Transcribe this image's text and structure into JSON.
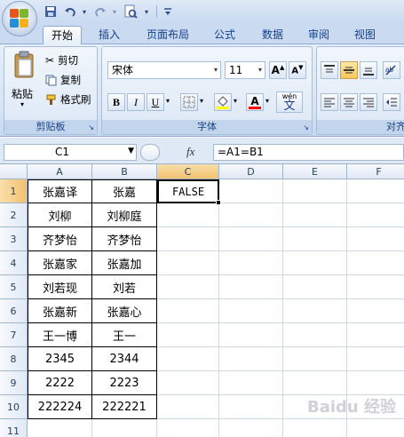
{
  "quick_access": {
    "icons": [
      "save-icon",
      "undo-icon",
      "redo-icon",
      "print-preview-icon",
      "customize-icon"
    ]
  },
  "tabs": [
    "开始",
    "插入",
    "页面布局",
    "公式",
    "数据",
    "审阅",
    "视图"
  ],
  "active_tab": "开始",
  "ribbon": {
    "clipboard": {
      "label": "剪贴板",
      "paste": "粘贴",
      "cut": "剪切",
      "copy": "复制",
      "format_painter": "格式刷"
    },
    "font": {
      "label": "字体",
      "font_name": "宋体",
      "font_size": "11",
      "bold": "B",
      "italic": "I",
      "underline": "U",
      "font_color_letter": "A",
      "phonetic": "wén"
    },
    "alignment": {
      "label": "对齐"
    }
  },
  "formula_bar": {
    "name_box": "C1",
    "fx": "fx",
    "formula": "=A1=B1"
  },
  "columns": [
    "A",
    "B",
    "C",
    "D",
    "E",
    "F"
  ],
  "selected_column": "C",
  "rows": [
    "1",
    "2",
    "3",
    "4",
    "5",
    "6",
    "7",
    "8",
    "9",
    "10",
    "11"
  ],
  "selected_row": "1",
  "cells": {
    "A": [
      "张嘉译",
      "刘柳",
      "齐梦怡",
      "张嘉家",
      "刘若现",
      "张嘉新",
      "王一博",
      "2345",
      "2222",
      "222224"
    ],
    "B": [
      "张嘉",
      "刘柳庭",
      "齐梦怡",
      "张嘉加",
      "刘若",
      "张嘉心",
      "王一",
      "2344",
      "2223",
      "222221"
    ],
    "C1": "FALSE"
  },
  "watermark": "Baidu 经验",
  "accent_colors": {
    "selection_header": "#f2c170",
    "ribbon_text": "#15428b"
  }
}
